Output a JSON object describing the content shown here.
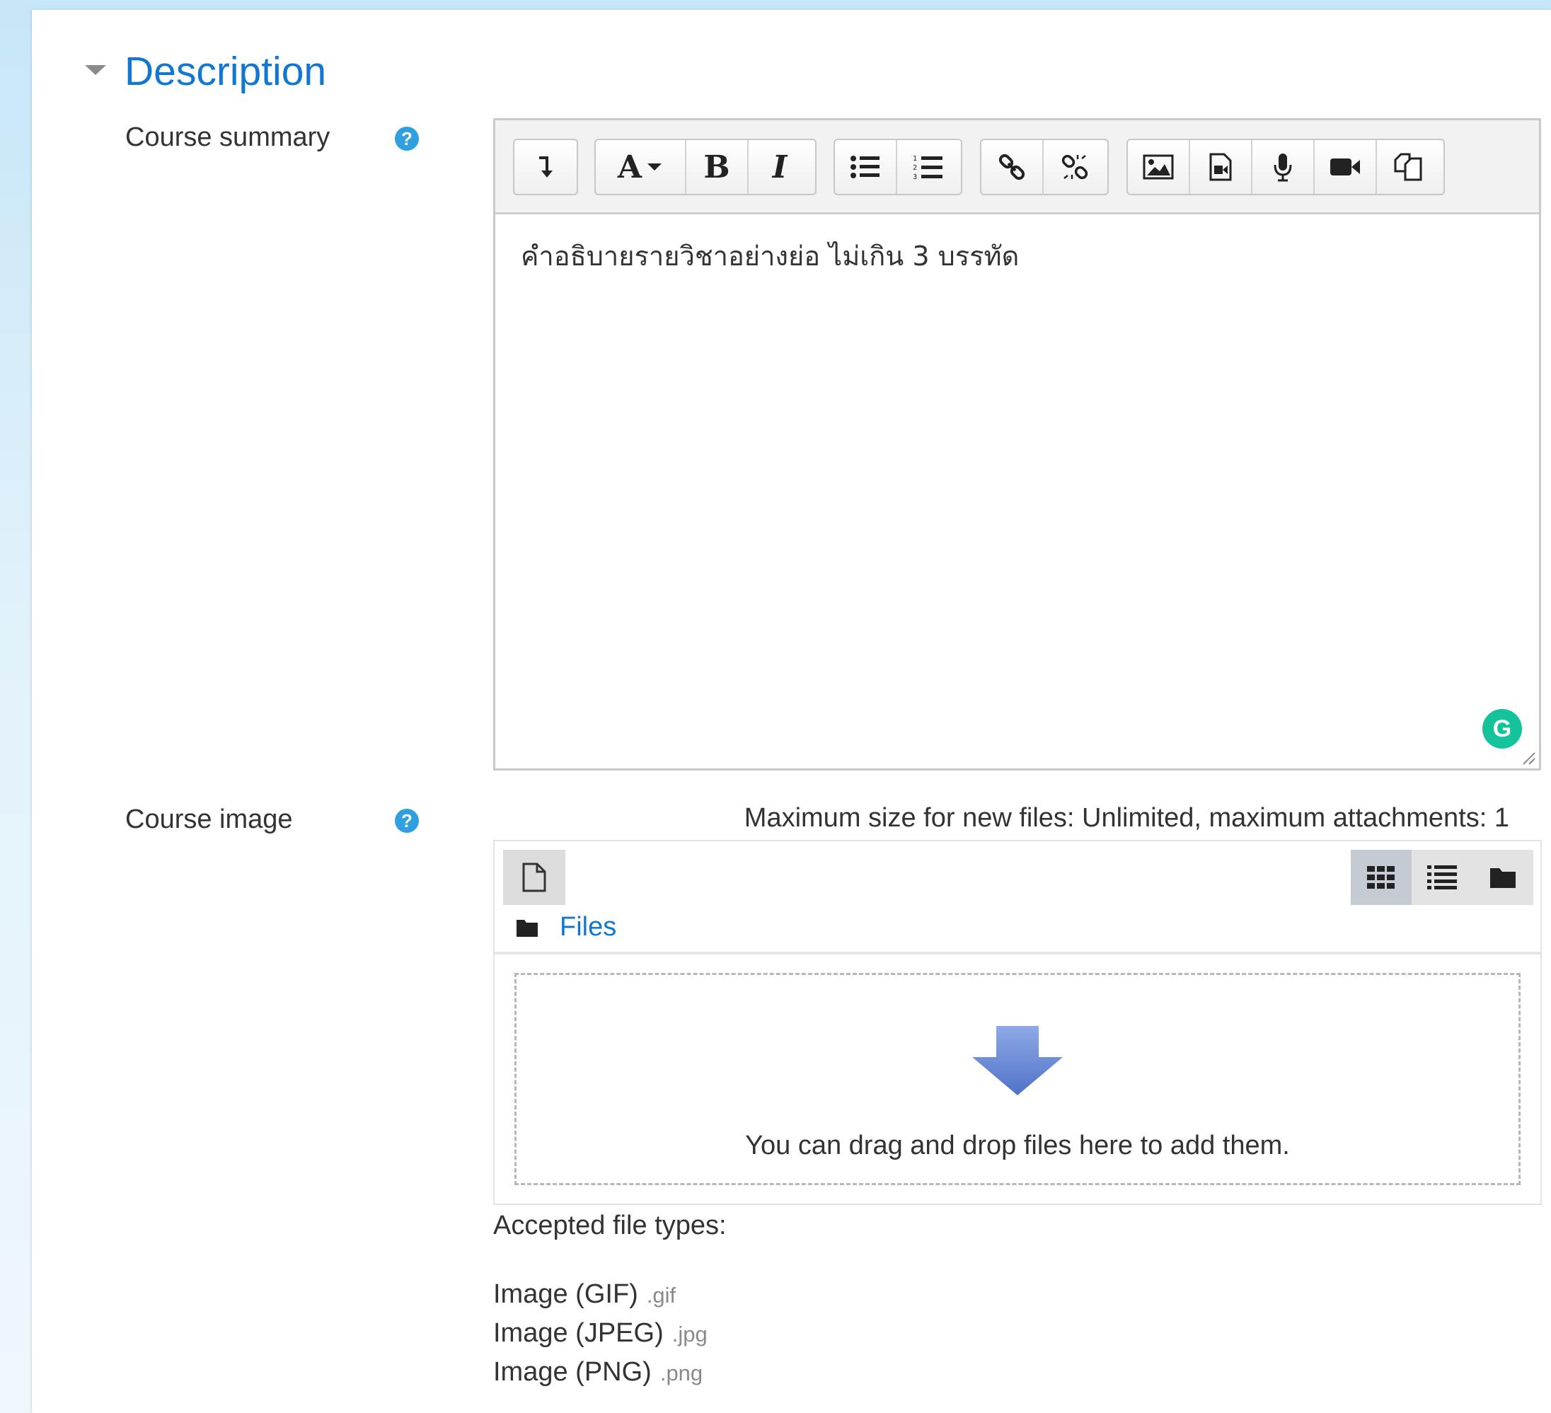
{
  "section": {
    "title": "Description"
  },
  "course_summary": {
    "label": "Course summary",
    "help_icon": "question-circle-icon",
    "editor_text": "คำอธิบายรายวิชาอย่างย่อ  ไม่เกิน 3 บรรทัด",
    "toolbar": [
      {
        "name": "show-more-buttons",
        "icon": "arrow-down-left-icon"
      },
      {
        "name": "font-style",
        "label": "A"
      },
      {
        "name": "bold",
        "label": "B"
      },
      {
        "name": "italic",
        "label": "I"
      },
      {
        "name": "unordered-list",
        "icon": "bullet-list-icon"
      },
      {
        "name": "ordered-list",
        "icon": "numbered-list-icon"
      },
      {
        "name": "link",
        "icon": "link-icon"
      },
      {
        "name": "unlink",
        "icon": "unlink-icon"
      },
      {
        "name": "image",
        "icon": "image-icon"
      },
      {
        "name": "media",
        "icon": "media-icon"
      },
      {
        "name": "record-audio",
        "icon": "microphone-icon"
      },
      {
        "name": "record-video",
        "icon": "video-camera-icon"
      },
      {
        "name": "manage-files",
        "icon": "copy-files-icon"
      }
    ],
    "grammarly_badge": "G"
  },
  "course_image": {
    "label": "Course image",
    "max_size_text": "Maximum size for new files: Unlimited, maximum attachments: 1",
    "path_label": "Files",
    "drop_text": "You can drag and drop files here to add them.",
    "accepted_title": "Accepted file types:",
    "types": [
      {
        "name": "Image (GIF)",
        "ext": ".gif"
      },
      {
        "name": "Image (JPEG)",
        "ext": ".jpg"
      },
      {
        "name": "Image (PNG)",
        "ext": ".png"
      }
    ],
    "colors": {
      "link": "#1177d1",
      "help": "#2f9fe0",
      "arrow": "#5b7fd0"
    }
  }
}
